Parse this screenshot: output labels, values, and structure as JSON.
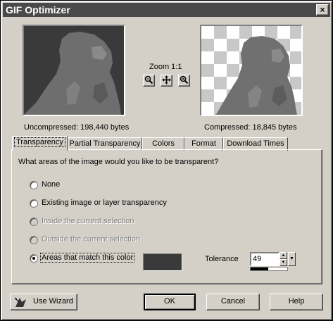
{
  "window": {
    "title": "GIF Optimizer",
    "close_glyph": "×"
  },
  "preview": {
    "uncompressed_label": "Uncompressed:  198,440 bytes",
    "compressed_label": "Compressed: 18,845 bytes",
    "zoom_label": "Zoom 1:1",
    "zoom_in_icon": "zoom-in-icon",
    "pan_icon": "pan-icon",
    "zoom_out_icon": "zoom-out-icon"
  },
  "tabs": [
    {
      "label": "Transparency",
      "active": true
    },
    {
      "label": "Partial Transparency",
      "active": false
    },
    {
      "label": "Colors",
      "active": false
    },
    {
      "label": "Format",
      "active": false
    },
    {
      "label": "Download Times",
      "active": false
    }
  ],
  "transparency": {
    "question": "What areas of the image would you like to be transparent?",
    "options": [
      {
        "label": "None",
        "checked": false,
        "enabled": true
      },
      {
        "label": "Existing image or layer transparency",
        "checked": false,
        "enabled": true
      },
      {
        "label": "Inside the current selection",
        "checked": false,
        "enabled": false
      },
      {
        "label": "Outside the current selection",
        "checked": false,
        "enabled": false
      },
      {
        "label": "Areas that match this color",
        "checked": true,
        "enabled": true
      }
    ],
    "match_color": "#3a3a3a",
    "tolerance_label": "Tolerance",
    "tolerance_value": "49",
    "tolerance_level": 0.49
  },
  "buttons": {
    "use_wizard": "Use Wizard",
    "ok": "OK",
    "cancel": "Cancel",
    "help": "Help"
  },
  "colors": {
    "title_bar": "#4a4a4a",
    "face": "#d4d0c8",
    "preview_bg": "#3a3a3a"
  }
}
